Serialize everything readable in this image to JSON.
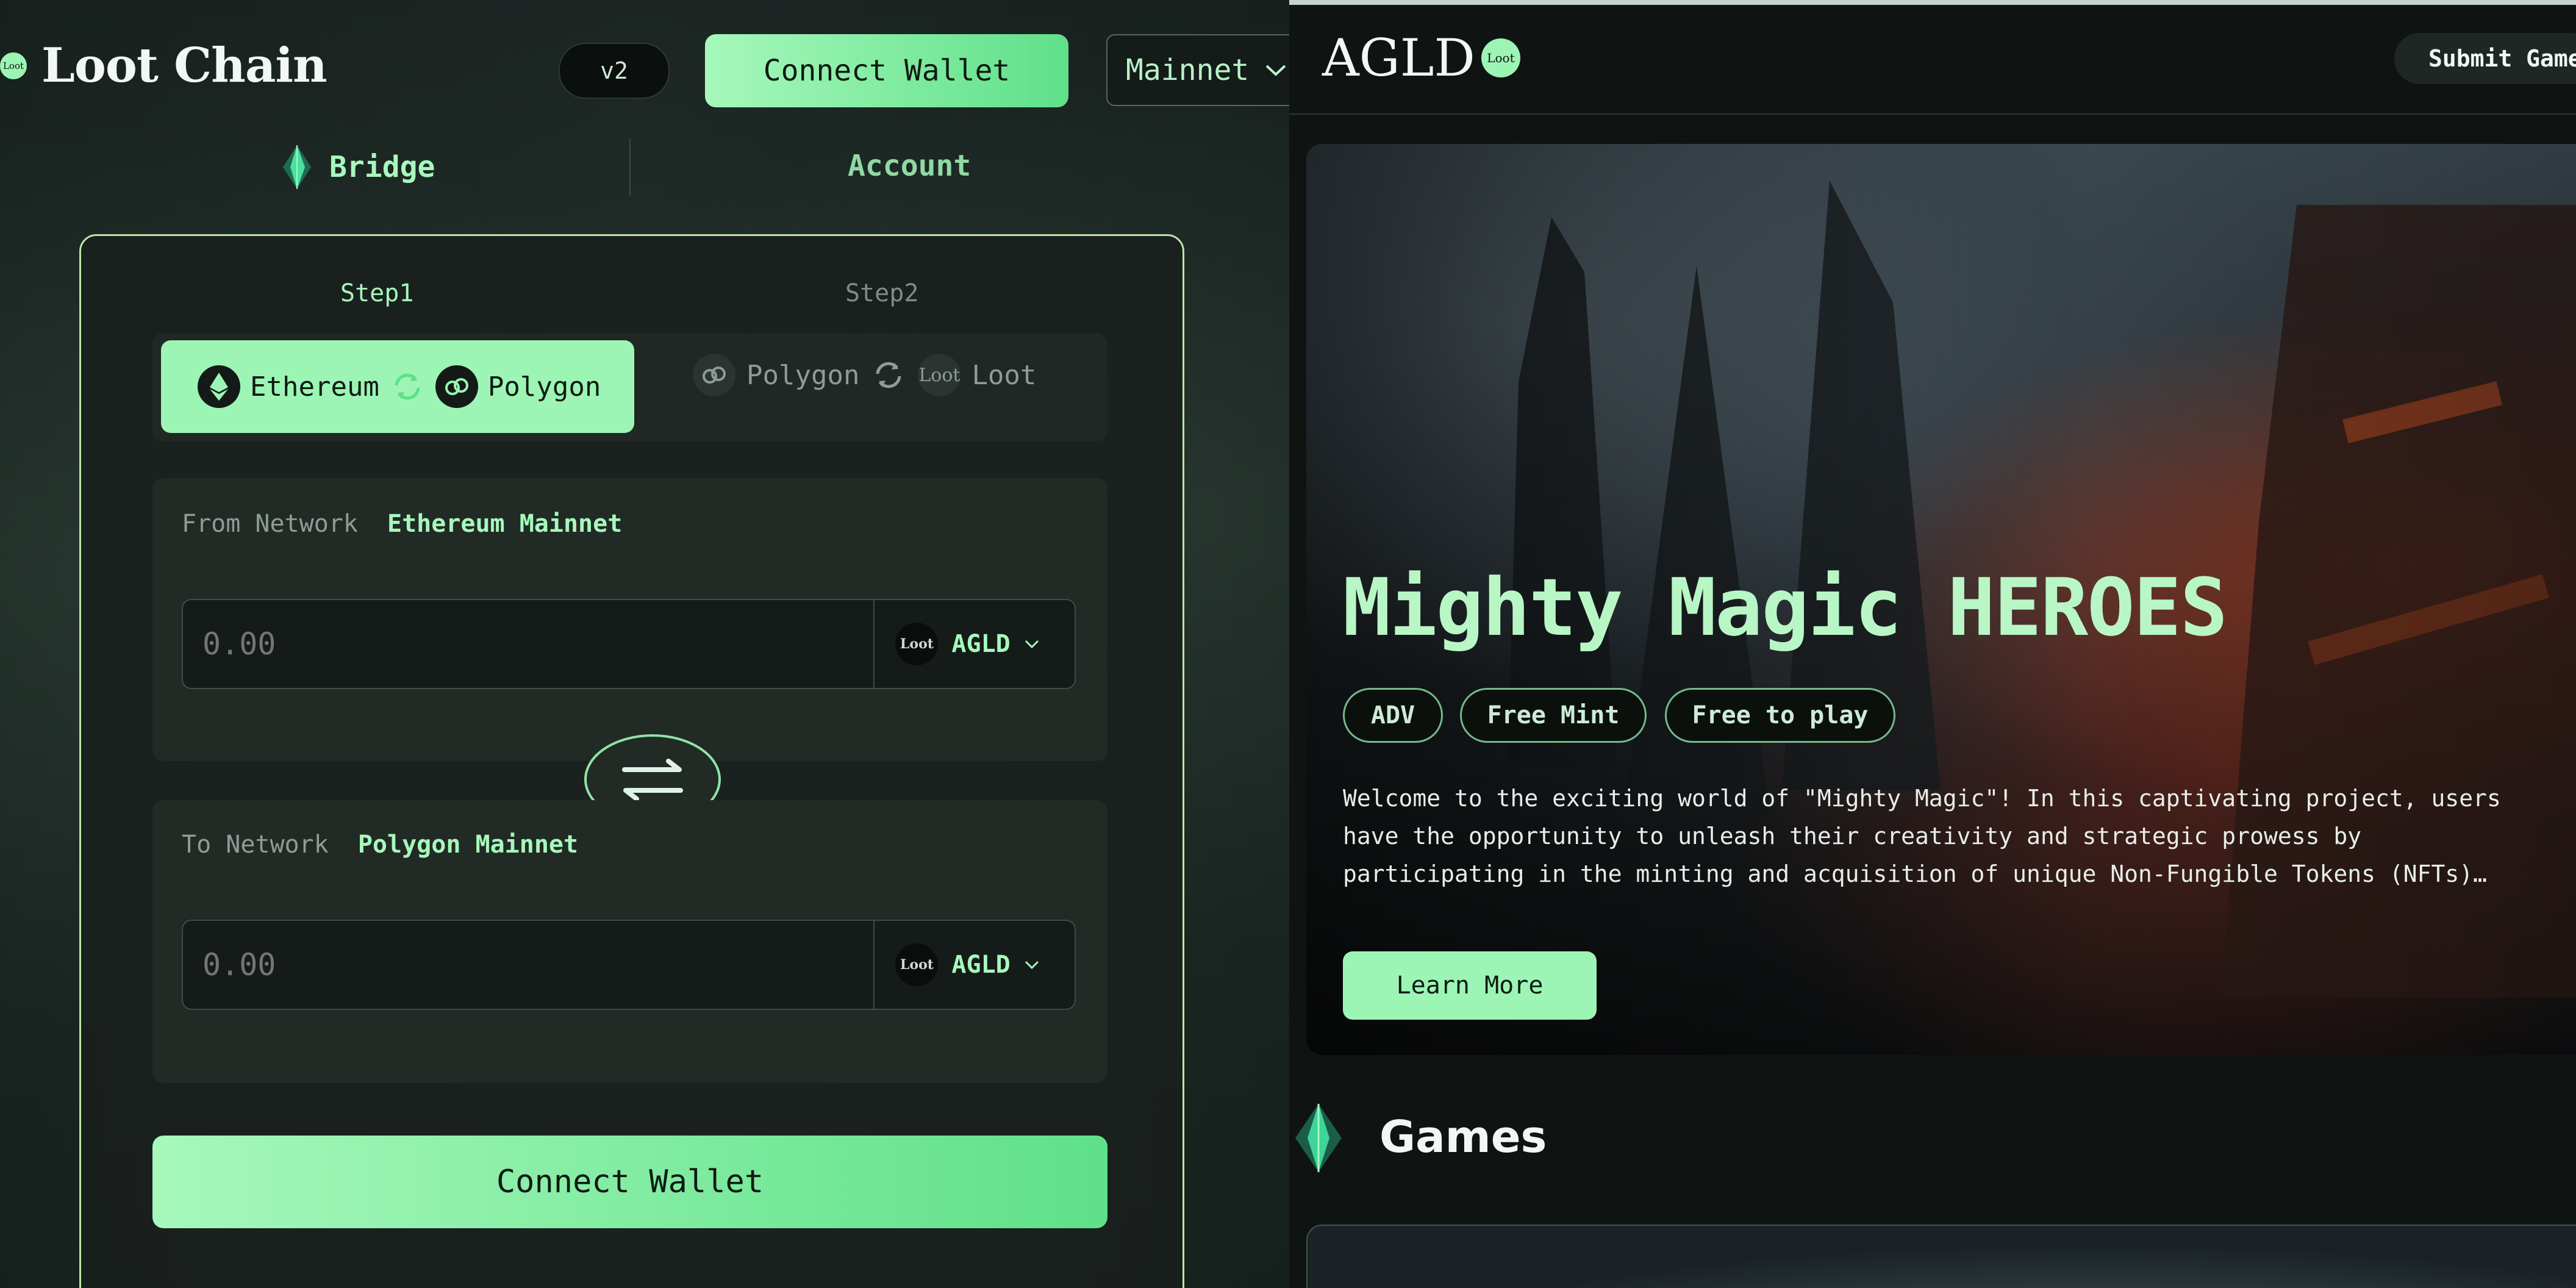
{
  "left": {
    "brand": {
      "logo_text": "Loot",
      "title": "Loot Chain"
    },
    "version": "v2",
    "header_connect": "Connect Wallet",
    "network_select": "Mainnet",
    "tabs": [
      {
        "label": "Bridge",
        "icon": "diamond-icon"
      },
      {
        "label": "Account"
      }
    ],
    "steps": [
      "Step1",
      "Step2"
    ],
    "routes": {
      "active": {
        "from": "Ethereum",
        "to": "Polygon"
      },
      "inactive": {
        "from": "Polygon",
        "to": "Loot",
        "to_icon_text": "Loot"
      }
    },
    "from": {
      "label": "From Network",
      "network": "Ethereum Mainnet",
      "placeholder": "0.00",
      "token": "AGLD",
      "token_icon_text": "Loot"
    },
    "to": {
      "label": "To Network",
      "network": "Polygon Mainnet",
      "placeholder": "0.00",
      "token": "AGLD",
      "token_icon_text": "Loot"
    },
    "connect_wallet": "Connect Wallet"
  },
  "right": {
    "brand": {
      "title": "AGLD",
      "logo_text": "Loot"
    },
    "submit": "Submit Game",
    "hero": {
      "title": "Mighty Magic HEROES",
      "tags": [
        "ADV",
        "Free Mint",
        "Free to play"
      ],
      "description": "Welcome to the exciting world of \"Mighty Magic\"! In this captivating project, users have the opportunity to unleash their creativity and strategic prowess by participating in the minting and acquisition of unique Non-Fungible Tokens (NFTs) representing mighty heroes. These heroes…",
      "cta": "Learn More"
    },
    "games_title": "Games"
  },
  "colors": {
    "accent": "#9cf5b4",
    "accent_dark": "#5fe08a",
    "bg": "#0f1412"
  }
}
